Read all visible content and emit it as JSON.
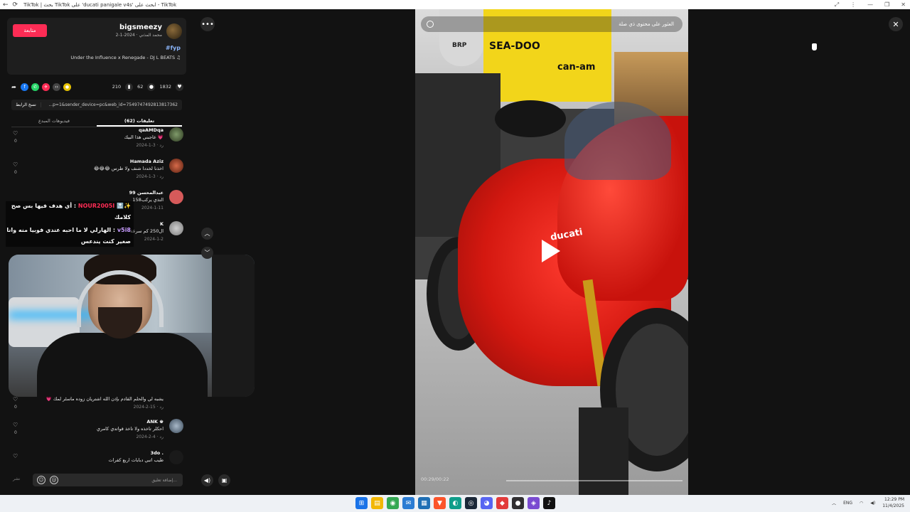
{
  "browser": {
    "title": "TikTok | بحث TikTok على 'ducati panigale v4s' ابحث على - TikTok",
    "back_icon": "←",
    "reload_icon": "⟳",
    "controls": [
      "⤢",
      "⋮",
      "—",
      "❐",
      "✕"
    ]
  },
  "author": {
    "name": "bigsmeezy",
    "subtitle": "محمد المذني · 2024-1-2",
    "follow_label": "متابعة",
    "hashtag": "#fyp",
    "music": "Under the Influence x Renegade - DJ L BEATS ♫"
  },
  "stats": {
    "likes": "1832",
    "comments": "62",
    "saves": "210",
    "share_platforms": [
      "coin",
      "embed",
      "tiktok",
      "whatsapp",
      "facebook",
      "share"
    ]
  },
  "link": {
    "copy_label": "نسخ الرابط",
    "url": "...p=1&sender_device=pc&web_id=7549747492813817362"
  },
  "tabs": [
    {
      "label": "تعليقات (62)",
      "active": true
    },
    {
      "label": "فيديوهات المبدع",
      "active": false
    }
  ],
  "comments": [
    {
      "name": "qaAMDqa",
      "text": "عاجبني هذا البيك 💗",
      "date": "2024-1-3",
      "reply": "رد",
      "likes": "0"
    },
    {
      "name": "Hamada Aziz",
      "text": "😂😂😂 اخذنا لخددا شنف ولا طرس",
      "date": "2024-1-3",
      "reply": "رد",
      "likes": "0"
    },
    {
      "name": "عبدالمحسن 99",
      "text": "158التذي يركب",
      "date": "2024-1-11",
      "reply": "",
      "likes": ""
    },
    {
      "name": "K",
      "text": "ال250 كم سرعة",
      "date": "2024-1-2",
      "reply": "",
      "likes": ""
    },
    {
      "name": "",
      "text": "💗 يشبه لي والحلم القادم بإذن الله اشتريان زوده ماسٹر لمك",
      "date": "2024-2-15",
      "reply": "رد",
      "likes": "0"
    },
    {
      "name": "ANK ♚",
      "text": "احكلر تاخذه ولا تاخذ قواتدي كامري",
      "date": "2024-2-4",
      "reply": "رد",
      "likes": "0"
    },
    {
      "name": "3do .",
      "text": "طيب اتبي دبابات اربع كفرات",
      "date": "",
      "reply": "",
      "likes": ""
    }
  ],
  "chat_overlay": [
    {
      "user": "NOUR2005I",
      "prefix_icons": "🔝✨",
      "text": "أي هدف فيها بس صح :"
    },
    {
      "user": "",
      "prefix_icons": "",
      "text": "كلامك"
    },
    {
      "user": "v5i8",
      "prefix_icons": "",
      "text": "الهارلي لا ما احبه عندي فوبيا منه وانا :"
    },
    {
      "user": "",
      "prefix_icons": "",
      "text": "صغير كنت يندعس"
    }
  ],
  "composer": {
    "placeholder": "إضافة تعليق...",
    "post_label": "نشر",
    "emoji_icon": "☺",
    "mention_icon": "@"
  },
  "video": {
    "search_placeholder": "العثور على محتوى ذي صلة",
    "sign_text_1": "SEA-DOO",
    "sign_text_2": "can-am",
    "brp_text": "BRP",
    "bike_logo": "ducati",
    "time": "00:29/00:22",
    "progress": 0.0
  },
  "taskbar": {
    "lang": "ENG",
    "time": "12:29 PM",
    "date": "11/4/2025",
    "apps": [
      {
        "name": "windows-start",
        "color": "#1a73e8",
        "glyph": "⊞"
      },
      {
        "name": "file-explorer",
        "color": "#f2b705",
        "glyph": "▤"
      },
      {
        "name": "chrome",
        "color": "#34a853",
        "glyph": "◉"
      },
      {
        "name": "mail",
        "color": "#2b7cd3",
        "glyph": "✉"
      },
      {
        "name": "store",
        "color": "#1f6fb5",
        "glyph": "▦"
      },
      {
        "name": "brave",
        "color": "#fb542b",
        "glyph": "▼"
      },
      {
        "name": "edge",
        "color": "#0f9d8a",
        "glyph": "◐"
      },
      {
        "name": "steam",
        "color": "#1b2838",
        "glyph": "◎"
      },
      {
        "name": "discord",
        "color": "#5865f2",
        "glyph": "◕"
      },
      {
        "name": "epic",
        "color": "#e23b3b",
        "glyph": "◆"
      },
      {
        "name": "obs",
        "color": "#302e31",
        "glyph": "●"
      },
      {
        "name": "game",
        "color": "#7a4bd1",
        "glyph": "◈"
      },
      {
        "name": "tiktok",
        "color": "#111111",
        "glyph": "♪"
      }
    ]
  },
  "colors": {
    "accent": "#fe2c55",
    "background": "#121212",
    "panel": "#1e1e1e"
  }
}
